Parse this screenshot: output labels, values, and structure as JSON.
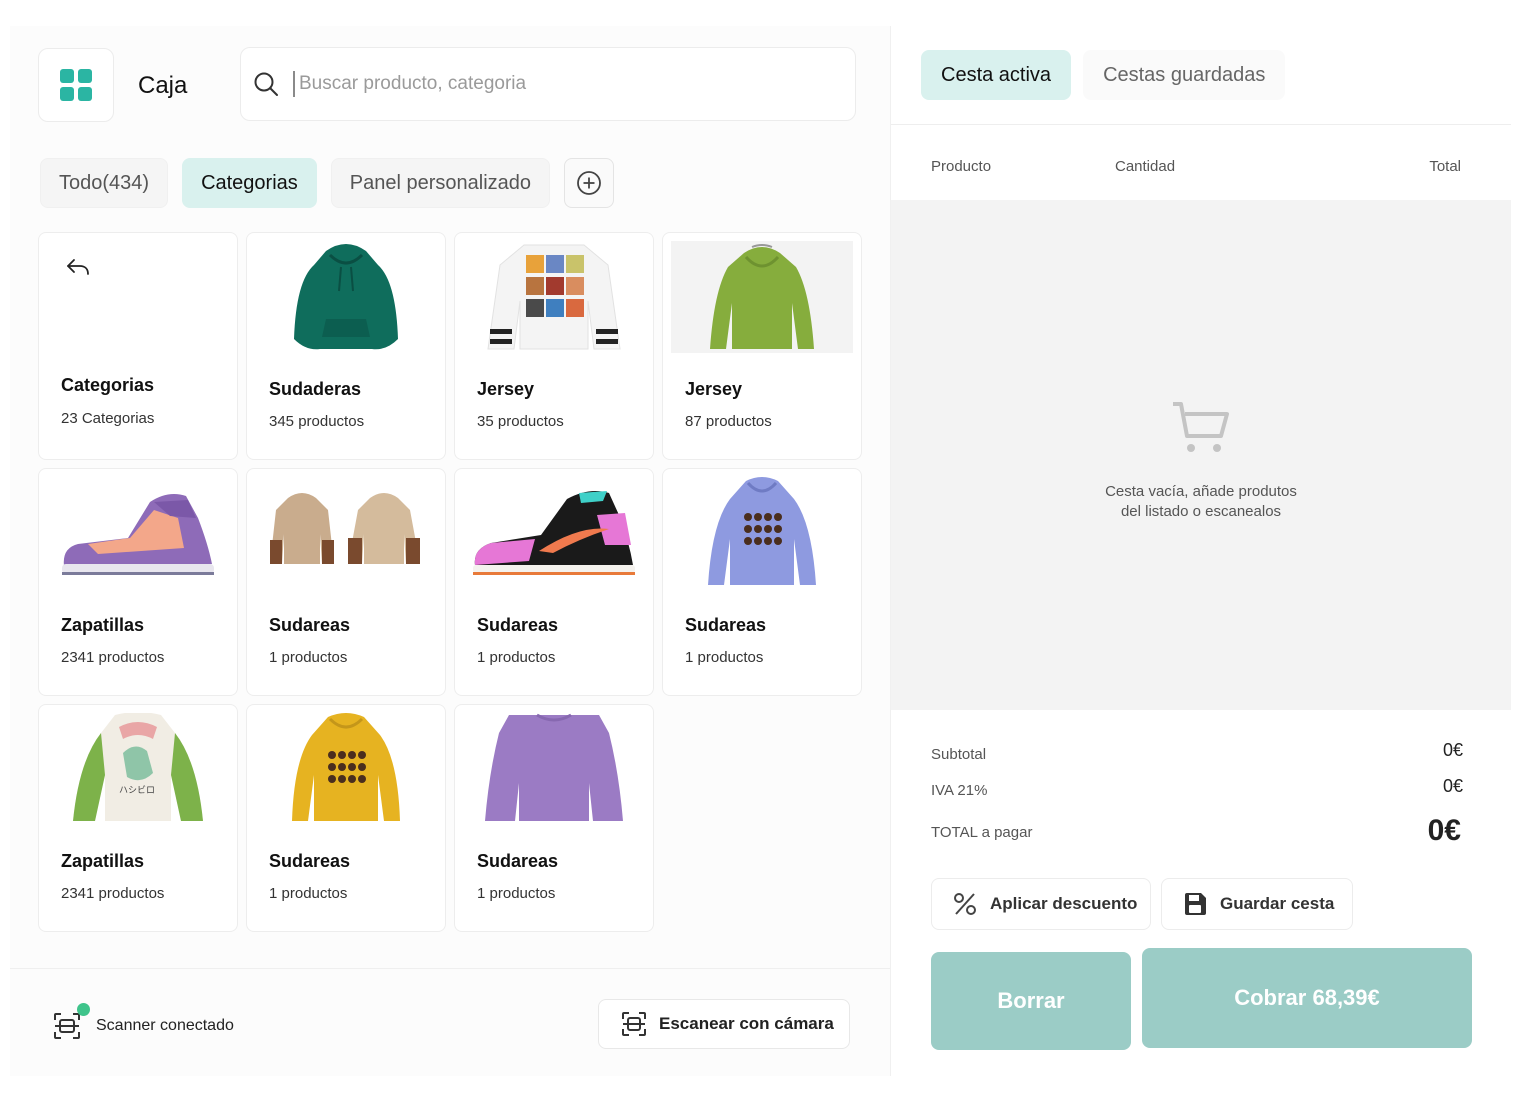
{
  "header": {
    "app_title": "Caja",
    "search_placeholder": "Buscar producto, categoria"
  },
  "tabs": [
    {
      "label": "Todo(434)",
      "active": false
    },
    {
      "label": "Categorias",
      "active": true
    },
    {
      "label": "Panel personalizado",
      "active": false
    }
  ],
  "cards": [
    {
      "name": "Categorias",
      "count": "23 Categorias",
      "icon": "back-arrow-icon"
    },
    {
      "name": "Sudaderas",
      "count": "345 productos",
      "icon": "hoodie-teal"
    },
    {
      "name": "Jersey",
      "count": "35 productos",
      "icon": "sweatshirt-white-print"
    },
    {
      "name": "Jersey",
      "count": "87 productos",
      "icon": "hoodie-green"
    },
    {
      "name": "Zapatillas",
      "count": "2341 productos",
      "icon": "sneaker-purple"
    },
    {
      "name": "Sudareas",
      "count": "1 productos",
      "icon": "hoodies-beige"
    },
    {
      "name": "Sudareas",
      "count": "1 productos",
      "icon": "sneaker-black-pink"
    },
    {
      "name": "Sudareas",
      "count": "1 productos",
      "icon": "hoodie-lavender"
    },
    {
      "name": "Zapatillas",
      "count": "2341 productos",
      "icon": "hoodie-dino"
    },
    {
      "name": "Sudareas",
      "count": "1 productos",
      "icon": "hoodie-yellow"
    },
    {
      "name": "Sudareas",
      "count": "1 productos",
      "icon": "sweater-purple"
    }
  ],
  "footer": {
    "scanner_label": "Scanner conectado",
    "camera_button": "Escanear con cámara"
  },
  "cart": {
    "tabs": [
      {
        "label": "Cesta activa",
        "active": true
      },
      {
        "label": "Cestas guardadas",
        "active": false
      }
    ],
    "columns": [
      "Producto",
      "Cantidad",
      "Total"
    ],
    "empty_line1": "Cesta vacía, añade produtos",
    "empty_line2": "del listado o escanealos",
    "subtotal_label": "Subtotal",
    "subtotal_value": "0€",
    "tax_label": "IVA 21%",
    "tax_value": "0€",
    "total_label": "TOTAL a pagar",
    "total_value": "0€",
    "discount_button": "Aplicar descuento",
    "save_button": "Guardar cesta",
    "clear_button": "Borrar",
    "charge_button": "Cobrar 68,39€"
  },
  "colors": {
    "accent": "#2bb5a3",
    "active_tab_bg": "#d9f1ee",
    "primary_button": "#9bccc6"
  }
}
